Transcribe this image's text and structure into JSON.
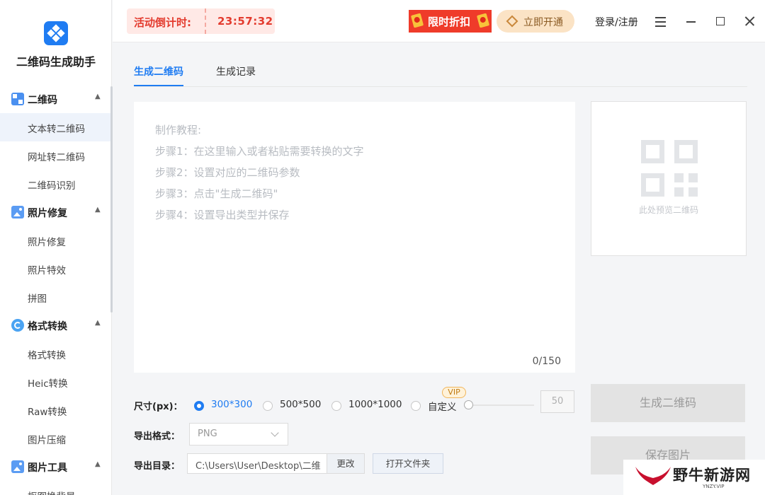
{
  "app": {
    "title": "二维码生成助手"
  },
  "sidebar": {
    "groups": [
      {
        "label": "二维码",
        "items": [
          "文本转二维码",
          "网址转二维码",
          "二维码识别"
        ]
      },
      {
        "label": "照片修复",
        "items": [
          "照片修复",
          "照片特效",
          "拼图"
        ]
      },
      {
        "label": "格式转换",
        "items": [
          "格式转换",
          "Heic转换",
          "Raw转换",
          "图片压缩"
        ]
      },
      {
        "label": "图片工具",
        "items": [
          "抠图换背景"
        ]
      }
    ],
    "active_item": "文本转二维码"
  },
  "topbar": {
    "countdown_label": "活动倒计时:",
    "countdown_time": "23:57:32",
    "promo_label": "限时折扣",
    "vip_label": "立即开通",
    "login_label": "登录/注册"
  },
  "tabs": [
    {
      "label": "生成二维码",
      "active": true
    },
    {
      "label": "生成记录",
      "active": false
    }
  ],
  "editor": {
    "placeholder_lines": [
      "制作教程:",
      "步骤1：在这里输入或者粘贴需要转换的文字",
      "步骤2：设置对应的二维码参数",
      "步骤3：点击\"生成二维码\"",
      "步骤4：设置导出类型并保存"
    ],
    "char_count": "0/150"
  },
  "preview": {
    "hint": "此处预览二维码"
  },
  "settings": {
    "size_label": "尺寸(px)：",
    "size_options": [
      "300*300",
      "500*500",
      "1000*1000",
      "自定义"
    ],
    "selected_size": "300*300",
    "vip_tag": "VIP",
    "custom_size_value": "50",
    "format_label": "导出格式：",
    "format_value": "PNG",
    "dir_label": "导出目录：",
    "dir_value": "C:\\Users\\User\\Desktop\\二维",
    "change_button": "更改",
    "open_folder_button": "打开文件夹"
  },
  "actions": {
    "generate": "生成二维码",
    "save": "保存图片"
  },
  "watermark": {
    "text": "野牛新游网",
    "sub": "YNZY.VIP"
  },
  "colors": {
    "accent": "#1f7cf2",
    "countdown": "#e33b2e",
    "promo": "#ef3b2a"
  }
}
